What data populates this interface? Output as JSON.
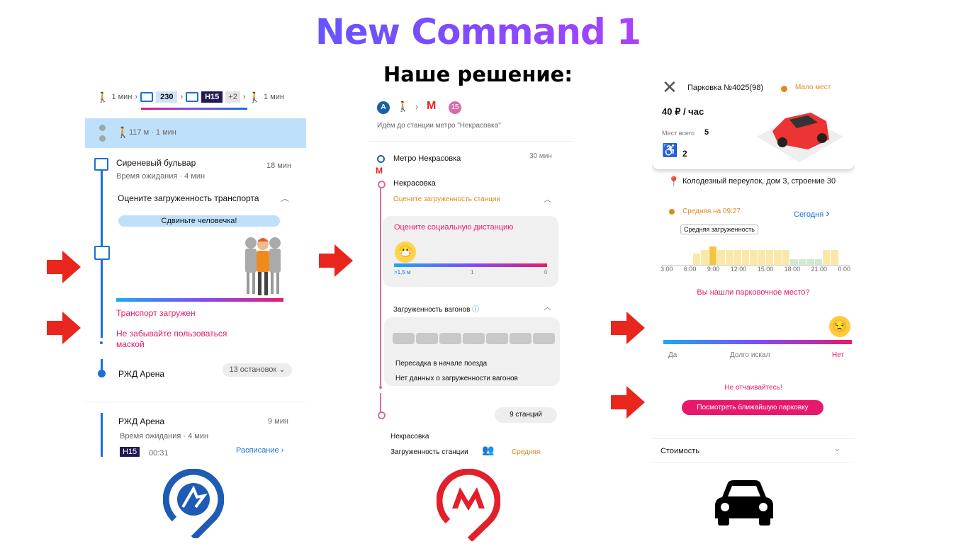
{
  "header": {
    "title": "New Command 1",
    "subtitle": "Наше решение:"
  },
  "colors": {
    "accent_pink": "#e8196d",
    "arrow_red": "#e8261d",
    "nav_blue": "#1b6fd6",
    "orange": "#e08a1e"
  },
  "panel1": {
    "route": {
      "walk1": "1 мин",
      "bus1": "230",
      "bus2": "Н15",
      "more": "+2",
      "walk2": "1 мин"
    },
    "walk_row": "117 м · 1 мин",
    "stop1": {
      "name": "Сиреневый бульвар",
      "time": "18 мин",
      "wait": "Время ожидания · 4 мин"
    },
    "rate_title": "Оцените загруженность транспорта",
    "slider_hint": "Сдвиньте человечка!",
    "load_status": "Транспорт загружен",
    "mask_note": "Не забывайте пользоваться маской",
    "stop2": {
      "name": "РЖД Арена",
      "stops": "13 остановок"
    },
    "stop3": {
      "name": "РЖД Арена",
      "time": "9 мин",
      "wait": "Время ожидания · 4 мин",
      "bus": "Н15",
      "dep": "00:31",
      "schedule": "Расписание"
    }
  },
  "panel2": {
    "route_a": "A",
    "route_m": "М",
    "route_15": "15",
    "walk_note": "Идём до станции метро \"Некрасовка\"",
    "metro": {
      "name": "Метро Некрасовка",
      "time": "30 мин"
    },
    "station": "Некрасовка",
    "rate_station": "Оцените загруженность станции",
    "social": {
      "title": "Оцените социальную дистанцию",
      "l1": ">1,5 м",
      "l2": "1",
      "l3": "0"
    },
    "cars_title": "Загруженность вагонов",
    "transfer": "Пересадка в начале поезда",
    "no_data": "Нет данных о загруженности вагонов",
    "stations": "9 станций",
    "end": {
      "name": "Некрасовка",
      "load_label": "Загруженность станции",
      "load_value": "Средняя"
    }
  },
  "panel3": {
    "parking": {
      "name": "Парковка №4025(98)",
      "status": "Мало мест",
      "price": "40 ₽ / час",
      "total_label": "Мест всего",
      "total": "5",
      "disabled": "2"
    },
    "address": "Колодезный переулок, дом 3, строение 30",
    "avg": "Средняя на 09:27",
    "today": "Сегодня",
    "tooltip": "Средняя загруженность",
    "hours": [
      "3:00",
      "6:00",
      "9:00",
      "12:00",
      "15:00",
      "18:00",
      "21:00",
      "0:00"
    ],
    "question": "Вы нашли парковочное место?",
    "scale": {
      "yes": "Да",
      "mid": "Долго искал",
      "no": "Нет"
    },
    "despair": "Не отчаивайтесь!",
    "nearest": "Посмотреть ближайшую парковку",
    "cost": "Стоимость",
    "bars": [
      0.6,
      0.8,
      1.0,
      0.8,
      0.8,
      0.8,
      0.8,
      0.8,
      0.8,
      0.8,
      0.8,
      0.8,
      0.3,
      0.3,
      0.3,
      0.3,
      0.8,
      0.8
    ]
  }
}
